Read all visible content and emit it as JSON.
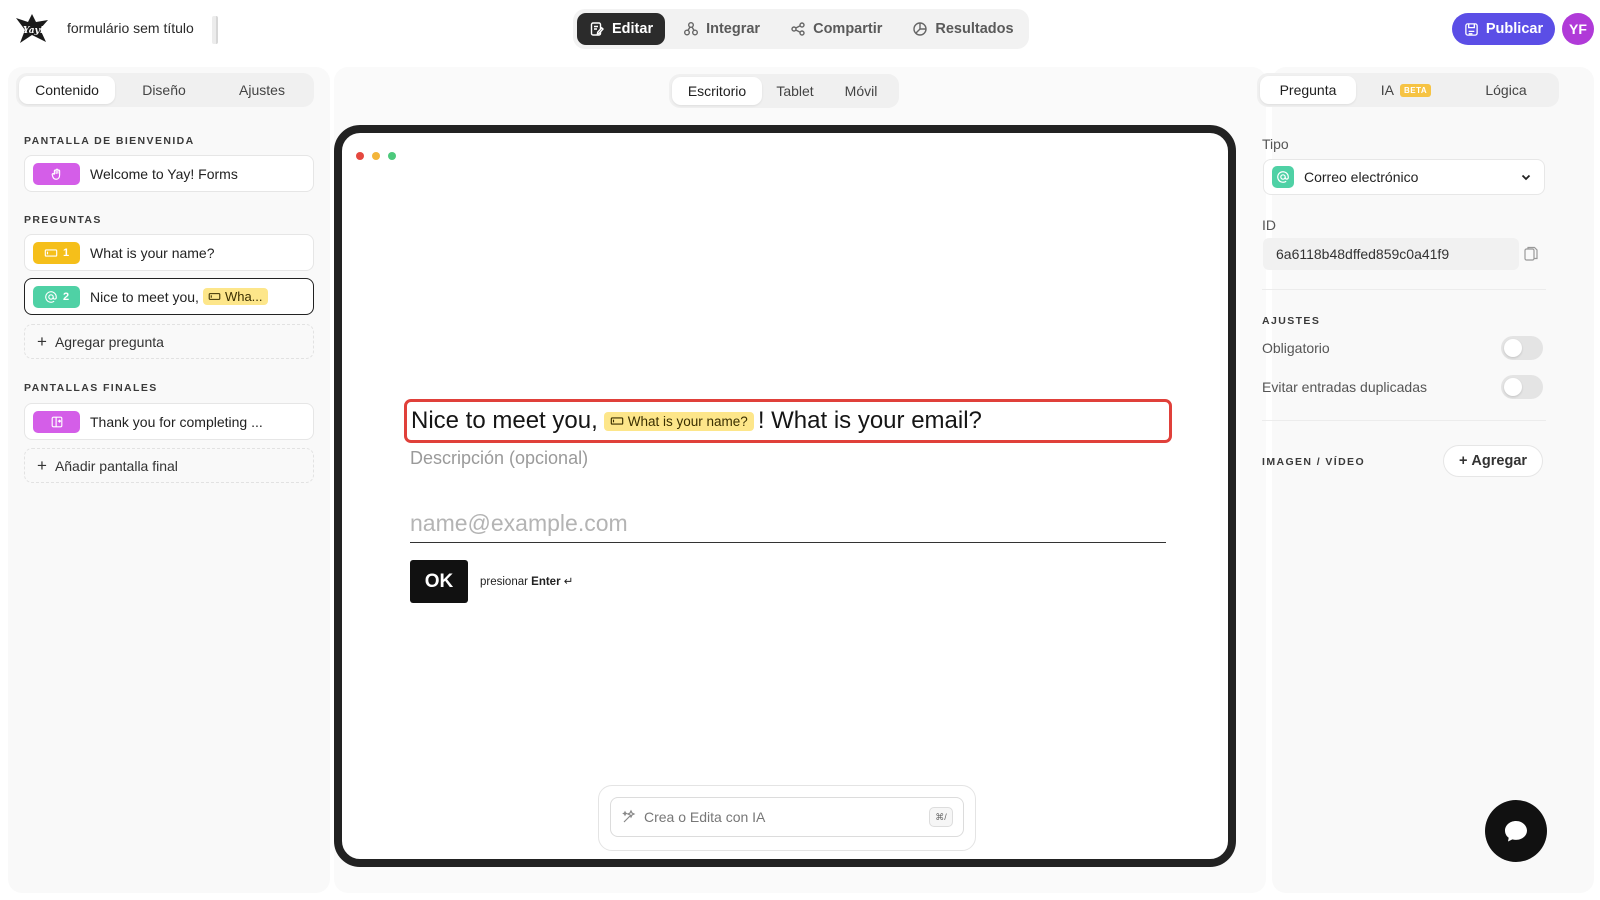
{
  "app": {
    "form_title": "formulário sem título",
    "avatar_initials": "YF",
    "publish_label": "Publicar",
    "brand_color": "#5b4ee6",
    "avatar_color": "#b03ad8"
  },
  "top_tabs": [
    {
      "label": "Editar",
      "icon": "edit-icon",
      "active": true
    },
    {
      "label": "Integrar",
      "icon": "integrate-icon",
      "active": false
    },
    {
      "label": "Compartir",
      "icon": "share-icon",
      "active": false
    },
    {
      "label": "Resultados",
      "icon": "results-icon",
      "active": false
    }
  ],
  "left_panel": {
    "tabs": [
      {
        "label": "Contenido",
        "active": true
      },
      {
        "label": "Diseño",
        "active": false
      },
      {
        "label": "Ajustes",
        "active": false
      }
    ],
    "welcome_section": "PANTALLA DE BIENVENIDA",
    "welcome_card": {
      "label": "Welcome to Yay! Forms",
      "icon": "hand-icon",
      "color": "#d45ee8"
    },
    "questions_section": "PREGUNTAS",
    "questions": [
      {
        "number": "1",
        "label": "What is your name?",
        "icon": "short-text-icon",
        "color": "#f5bf1a"
      },
      {
        "number": "2",
        "label": "Nice to meet you,",
        "ref": "Wha...",
        "icon": "at-icon",
        "color": "#4fd1a5",
        "selected": true
      }
    ],
    "add_question": "Agregar pregunta",
    "endings_section": "PANTALLAS FINALES",
    "ending_card": {
      "label": "Thank you for completing ...",
      "icon": "exit-icon",
      "color": "#d45ee8"
    },
    "add_ending": "Añadir pantalla final"
  },
  "preview": {
    "device_tabs": [
      {
        "label": "Escritorio",
        "active": true
      },
      {
        "label": "Tablet",
        "active": false
      },
      {
        "label": "Móvil",
        "active": false
      }
    ],
    "question_prefix": "Nice to meet you,",
    "question_ref": "What is your name?",
    "question_suffix": "! What is your email?",
    "description_placeholder": "Descripción (opcional)",
    "input_placeholder": "name@example.com",
    "ok_label": "OK",
    "hint_prefix": "presionar",
    "hint_key": "Enter",
    "hint_symbol": "↵",
    "ai_placeholder": "Crea o Edita con IA",
    "ai_shortcut": "⌘/"
  },
  "right_panel": {
    "tabs": [
      {
        "label": "Pregunta",
        "active": true
      },
      {
        "label": "IA",
        "badge": "BETA",
        "active": false
      },
      {
        "label": "Lógica",
        "active": false
      }
    ],
    "type_label": "Tipo",
    "type_value": "Correo electrónico",
    "id_label": "ID",
    "id_value": "6a6118b48dffed859c0a41f9",
    "settings_section": "AJUSTES",
    "toggles": [
      {
        "label": "Obligatorio",
        "on": false
      },
      {
        "label": "Evitar entradas duplicadas",
        "on": false
      }
    ],
    "media_section": "IMAGEN / VÍDEO",
    "add_media": "Agregar"
  }
}
